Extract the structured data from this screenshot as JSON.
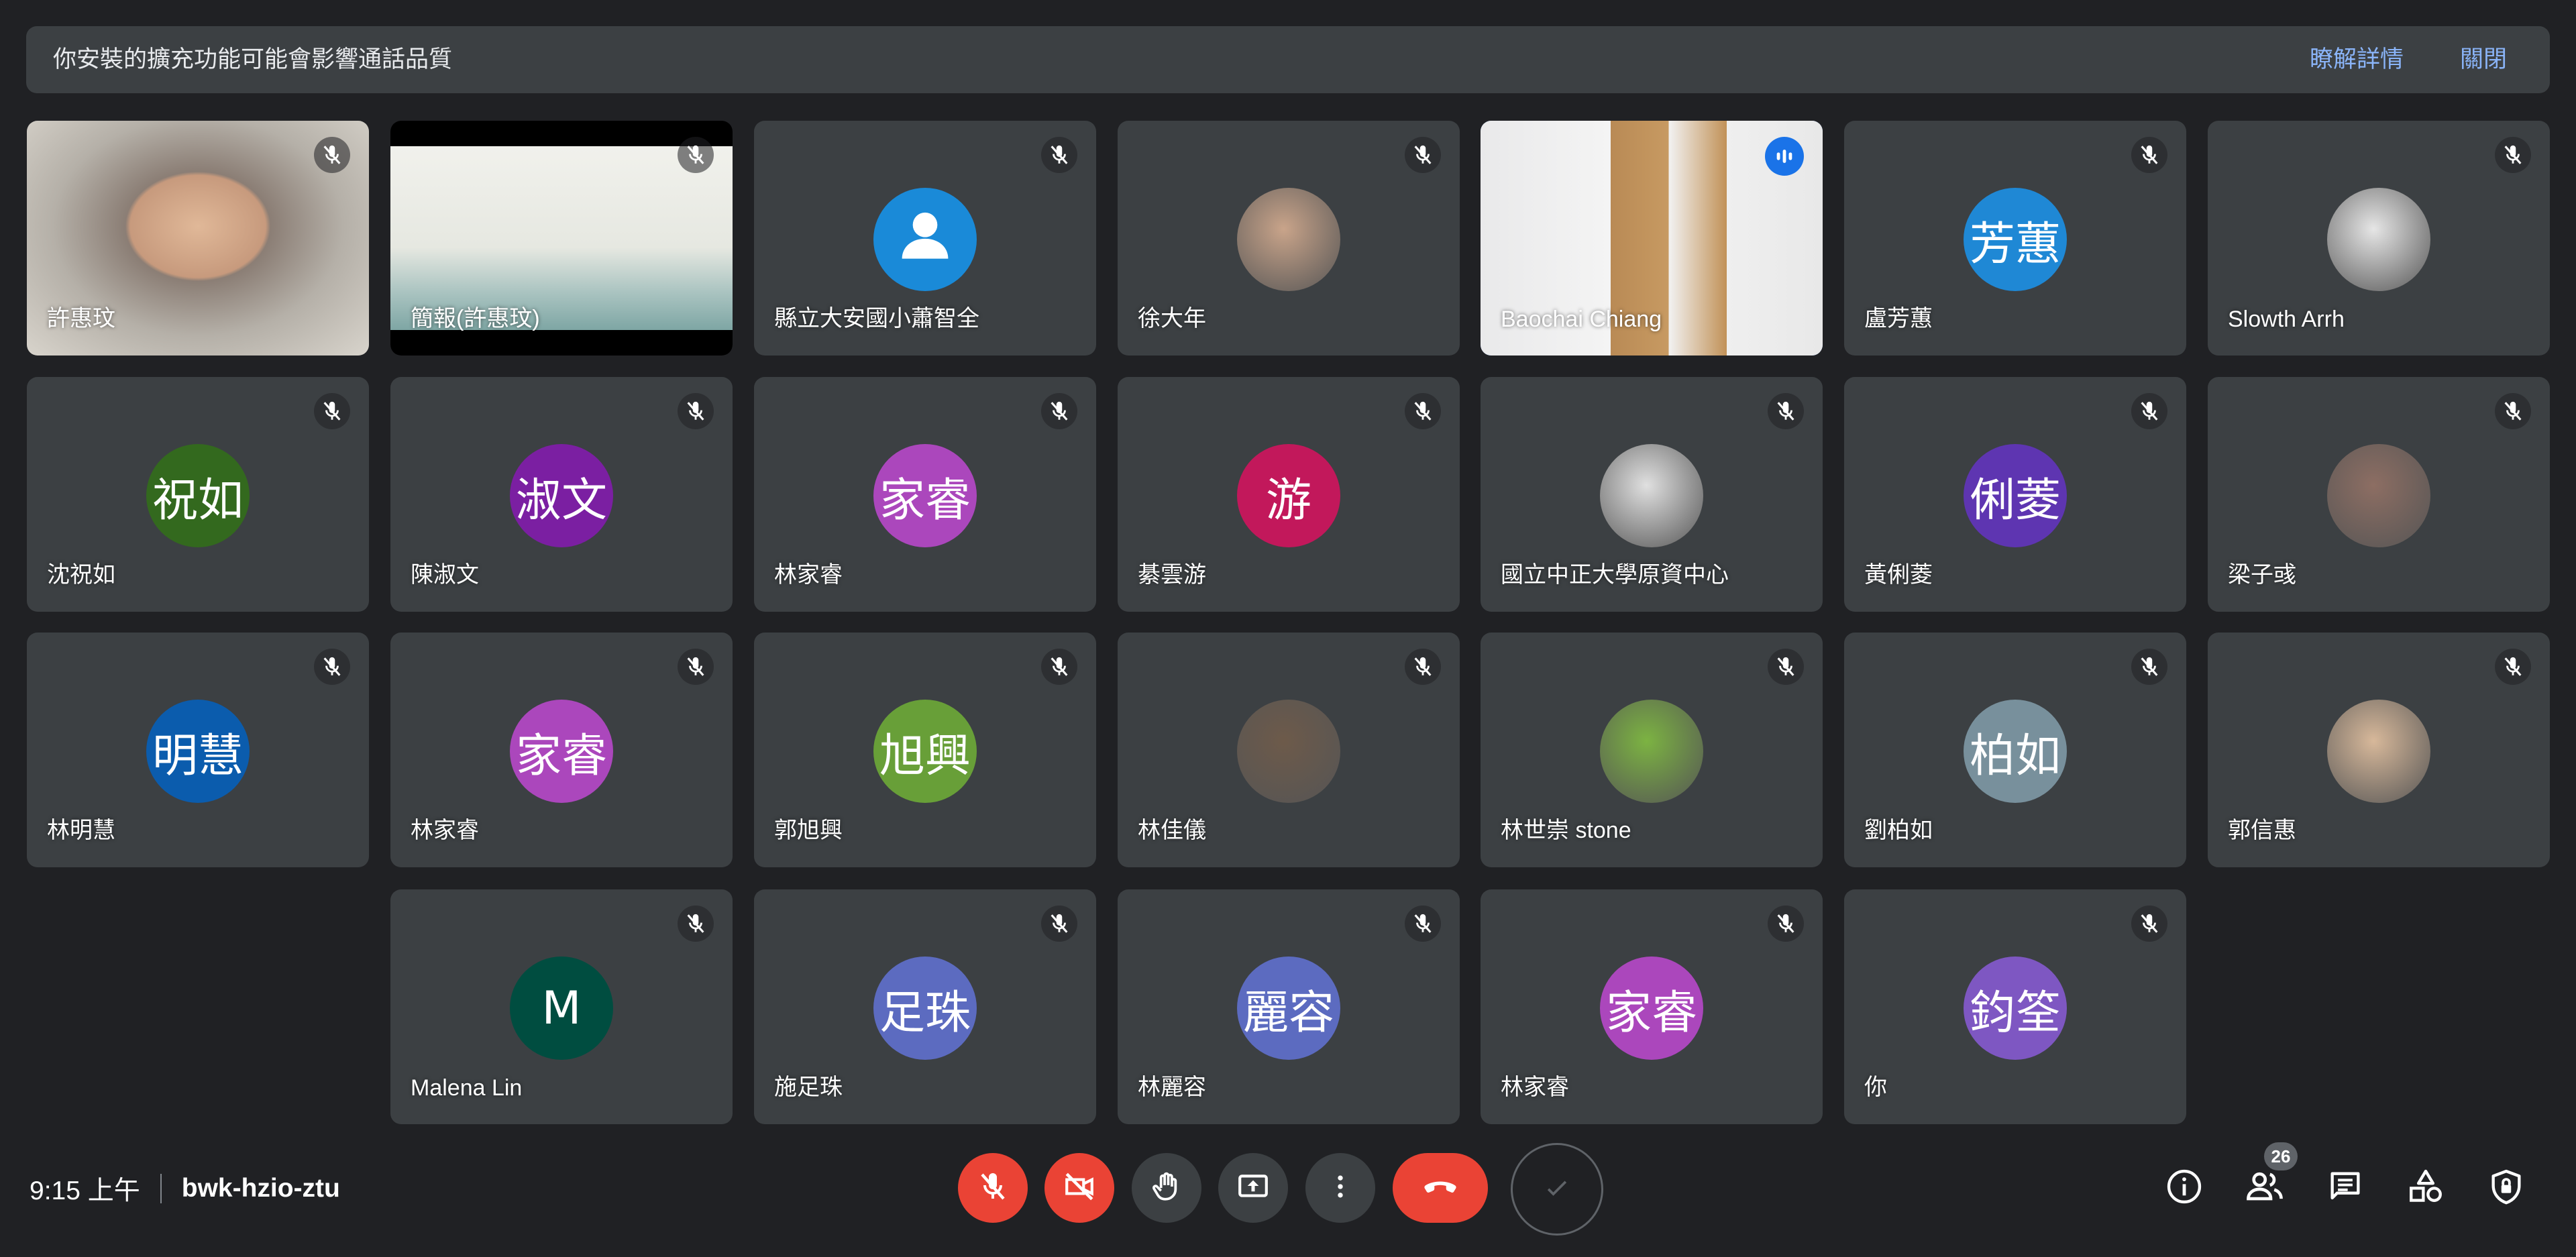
{
  "banner": {
    "message": "你安裝的擴充功能可能會影響通話品質",
    "learn_more": "瞭解詳情",
    "close": "關閉"
  },
  "participants": [
    {
      "name": "許惠玟",
      "type": "video"
    },
    {
      "name": "簡報(許惠玟)",
      "type": "presentation"
    },
    {
      "name": "縣立大安國小蕭智全",
      "type": "avatar",
      "avatar_icon": "person-icon",
      "avatar_color": "#1a8ad8"
    },
    {
      "name": "徐大年",
      "type": "avatar-photo",
      "avatar_color": "#c9a48a"
    },
    {
      "name": "Baochai Chiang",
      "type": "video",
      "speaking": true
    },
    {
      "name": "盧芳蕙",
      "type": "avatar",
      "initials": "芳蕙",
      "avatar_color": "#1f88d5"
    },
    {
      "name": "Slowth Arrh",
      "type": "avatar-photo",
      "avatar_color": "#e6e6e6"
    },
    {
      "name": "沈祝如",
      "type": "avatar",
      "initials": "祝如",
      "avatar_color": "#33691e"
    },
    {
      "name": "陳淑文",
      "type": "avatar",
      "initials": "淑文",
      "avatar_color": "#7b1fa2"
    },
    {
      "name": "林家睿",
      "type": "avatar",
      "initials": "家睿",
      "avatar_color": "#ab47bc"
    },
    {
      "name": "綦雲游",
      "type": "avatar",
      "initials": "游",
      "avatar_color": "#c2185b"
    },
    {
      "name": "國立中正大學原資中心",
      "type": "avatar-photo",
      "avatar_color": "#e0e0e0"
    },
    {
      "name": "黃俐菱",
      "type": "avatar",
      "initials": "俐菱",
      "avatar_color": "#5e35b1"
    },
    {
      "name": "梁子彧",
      "type": "avatar-photo",
      "avatar_color": "#8d6e63"
    },
    {
      "name": "林明慧",
      "type": "avatar",
      "initials": "明慧",
      "avatar_color": "#0b5cad"
    },
    {
      "name": "林家睿",
      "type": "avatar",
      "initials": "家睿",
      "avatar_color": "#ab47bc"
    },
    {
      "name": "郭旭興",
      "type": "avatar",
      "initials": "旭興",
      "avatar_color": "#689f38"
    },
    {
      "name": "林佳儀",
      "type": "avatar-photo",
      "avatar_color": "#6d5a4a"
    },
    {
      "name": "林世崇 stone",
      "type": "avatar-photo",
      "avatar_color": "#7cb342"
    },
    {
      "name": "劉柏如",
      "type": "avatar",
      "initials": "柏如",
      "avatar_color": "#78909c"
    },
    {
      "name": "郭信惠",
      "type": "avatar-photo",
      "avatar_color": "#d7b89a"
    },
    {
      "name": "Malena Lin",
      "type": "avatar",
      "initials": "M",
      "avatar_color": "#004d40"
    },
    {
      "name": "施足珠",
      "type": "avatar",
      "initials": "足珠",
      "avatar_color": "#5c6bc0"
    },
    {
      "name": "林麗容",
      "type": "avatar",
      "initials": "麗容",
      "avatar_color": "#5c6bc0"
    },
    {
      "name": "林家睿",
      "type": "avatar",
      "initials": "家睿",
      "avatar_color": "#ab47bc"
    },
    {
      "name": "你",
      "type": "avatar",
      "initials": "鈞筌",
      "avatar_color": "#7e57c2"
    }
  ],
  "meeting": {
    "time": "9:15 上午",
    "code": "bwk-hzio-ztu"
  },
  "controls": {
    "people_count": "26"
  },
  "colors": {
    "background": "#202124",
    "tile": "#3c4043",
    "danger": "#ea4335",
    "accent": "#8ab4f8"
  }
}
